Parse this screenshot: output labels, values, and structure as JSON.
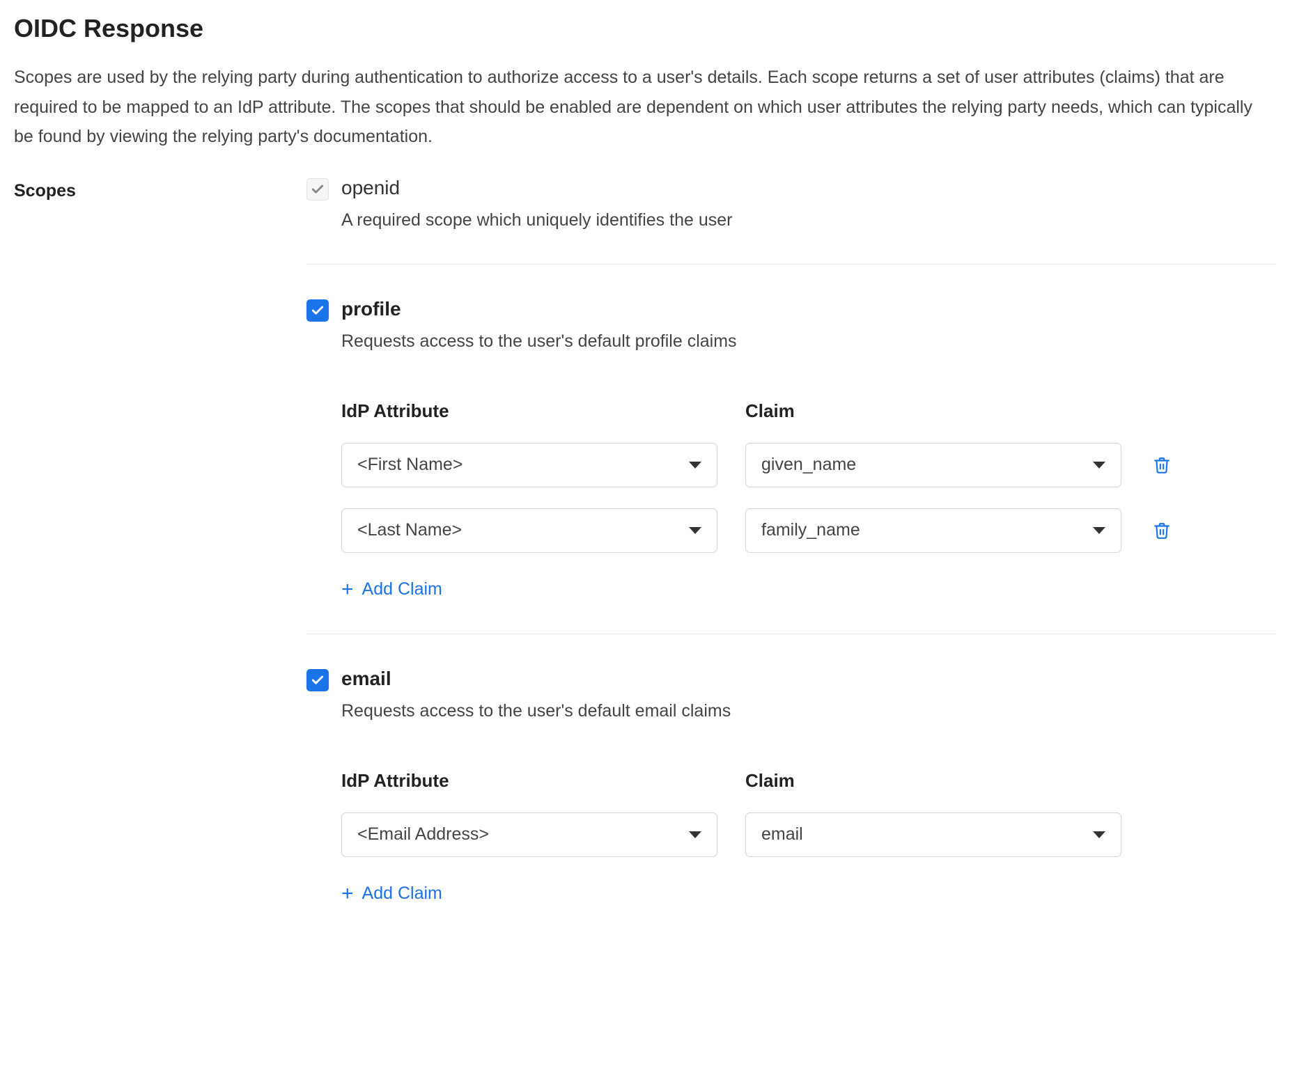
{
  "title": "OIDC Response",
  "intro": "Scopes are used by the relying party during authentication to authorize access to a user's details. Each scope returns a set of user attributes (claims) that are required to be mapped to an IdP attribute. The scopes that should be enabled are dependent on which user attributes the relying party needs, which can typically be found by viewing the relying party's documentation.",
  "labels": {
    "scopes": "Scopes",
    "idp_attribute": "IdP Attribute",
    "claim": "Claim",
    "add_claim": "Add Claim"
  },
  "scopes": {
    "openid": {
      "name": "openid",
      "description": "A required scope which uniquely identifies the user",
      "checked": true,
      "disabled": true
    },
    "profile": {
      "name": "profile",
      "description": "Requests access to the user's default profile claims",
      "checked": true,
      "disabled": false,
      "claims": [
        {
          "idp": "<First Name>",
          "claim": "given_name",
          "deletable": true
        },
        {
          "idp": "<Last Name>",
          "claim": "family_name",
          "deletable": true
        }
      ]
    },
    "email": {
      "name": "email",
      "description": "Requests access to the user's default email claims",
      "checked": true,
      "disabled": false,
      "claims": [
        {
          "idp": "<Email Address>",
          "claim": "email",
          "deletable": false
        }
      ]
    }
  }
}
